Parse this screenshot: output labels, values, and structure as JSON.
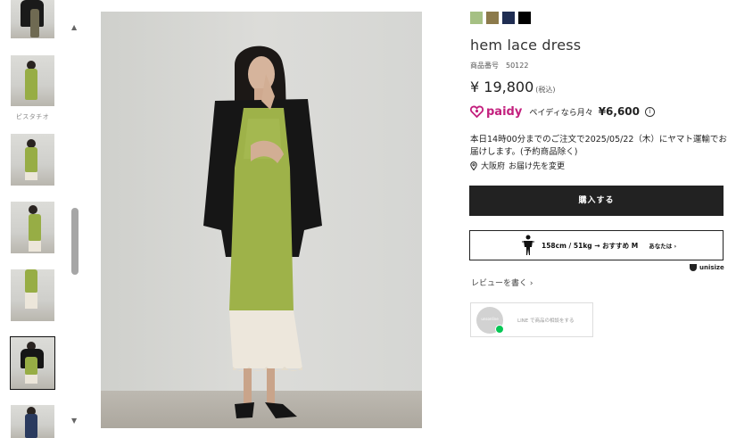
{
  "thumbnails": {
    "items": [
      {
        "name": "thumb-1"
      },
      {
        "name": "thumb-2",
        "caption": "ピスタチオ"
      },
      {
        "name": "thumb-3"
      },
      {
        "name": "thumb-4"
      },
      {
        "name": "thumb-5"
      },
      {
        "name": "thumb-6",
        "selected": true
      },
      {
        "name": "thumb-7"
      }
    ],
    "scroll_up_icon": "triangle-up",
    "scroll_down_icon": "triangle-down"
  },
  "product": {
    "swatch_colors": [
      "#a5c083",
      "#8c7a4b",
      "#1f2d52",
      "#000000"
    ],
    "title": "hem lace dress",
    "product_no_label": "商品番号",
    "product_no": "50122",
    "price": "¥ 19,800",
    "tax_note": "(税込)",
    "paidy": {
      "logo_text": "paidy",
      "text": "ペイディなら月々",
      "amount": "¥6,600",
      "info_icon": "i"
    },
    "delivery_text": "本日14時00分までのご注文で2025/05/22（木）にヤマト運輸でお届けします。(予約商品除く)",
    "location": "大阪府",
    "location_change": "お届け先を変更",
    "buy_label": "購入する",
    "unisize": {
      "recommend": "158cm / 51kg → おすすめ M",
      "you_label": "あなたは",
      "brand": "unisize"
    },
    "review_label": "レビューを書く",
    "line_box": {
      "avatar_text": "unsonline",
      "text": "LINE で商品の相談をする"
    }
  },
  "colors": {
    "buy_button_bg": "#222222",
    "paidy_brand": "#c3207e",
    "line_green": "#06c755"
  }
}
